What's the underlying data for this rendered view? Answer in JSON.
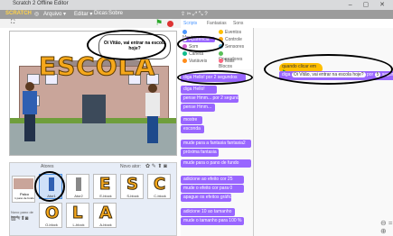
{
  "window": {
    "title": "Scratch 2 Offline Editor",
    "controls": "– ▢ ✕"
  },
  "menubar": {
    "logo": "SCRATCH",
    "items": [
      "Arquivo ▾",
      "Editar ▾",
      "Dicas",
      "Sobre"
    ]
  },
  "tabs": [
    "Scripts",
    "Fantasias",
    "Sons"
  ],
  "stage": {
    "banner": "ESCOLA",
    "speech": "Oi Vitão, vai entrar na escola hoje?"
  },
  "categories": [
    {
      "label": "Movimento",
      "color": "#4c97ff"
    },
    {
      "label": "Aparência",
      "color": "#9966ff"
    },
    {
      "label": "Som",
      "color": "#cf63cf"
    },
    {
      "label": "Caneta",
      "color": "#0fbd8c"
    },
    {
      "label": "Variáveis",
      "color": "#ff8c1a"
    },
    {
      "label": "Eventos",
      "color": "#ffbf00"
    },
    {
      "label": "Controle",
      "color": "#ffab19"
    },
    {
      "label": "Sensores",
      "color": "#5cb1d6"
    },
    {
      "label": "Operadores",
      "color": "#59c059"
    },
    {
      "label": "Mais Blocos",
      "color": "#ff6680"
    }
  ],
  "blocks": [
    "diga Hello! por 2 segundos",
    "diga Hello!",
    "pense Hmm... por 2 segundos",
    "pense Hmm...",
    "mostre",
    "esconda",
    "mude para a fantasia fantasia2",
    "próxima fantasia",
    "mude para o pano de fundo",
    "adicione ao efeito cor 25",
    "mude o efeito cor para 0",
    "apague os efeitos gráficos",
    "adicione 10 ao tamanho",
    "mude o tamanho para 100 %"
  ],
  "script": {
    "hat": "quando clicar em",
    "say_prefix": "diga",
    "say_text": "Oi Vitão, vai entrar na escola hoje?",
    "say_for": "por",
    "say_secs": "5",
    "say_unit": "segundos"
  },
  "sprites": {
    "header_label": "Atores",
    "new_sprite_label": "Novo ator:",
    "stage_label": "Palco",
    "stage_sub": "1 pano de fundo",
    "new_backdrop": "Novo pano de fundo:",
    "items": [
      {
        "name": "Ator1",
        "letter": "",
        "selected": true
      },
      {
        "name": "Ator2",
        "letter": "",
        "selected": false
      },
      {
        "name": "E-block",
        "letter": "E",
        "selected": false
      },
      {
        "name": "S-block",
        "letter": "S",
        "selected": false
      },
      {
        "name": "C-block",
        "letter": "C",
        "selected": false
      },
      {
        "name": "O-block",
        "letter": "O",
        "selected": false
      },
      {
        "name": "L-block",
        "letter": "L",
        "selected": false
      },
      {
        "name": "A-block",
        "letter": "A",
        "selected": false
      }
    ]
  },
  "colors": {
    "looks": "#9966ff",
    "events": "#ffbf00",
    "accent": "#4c97ff"
  }
}
